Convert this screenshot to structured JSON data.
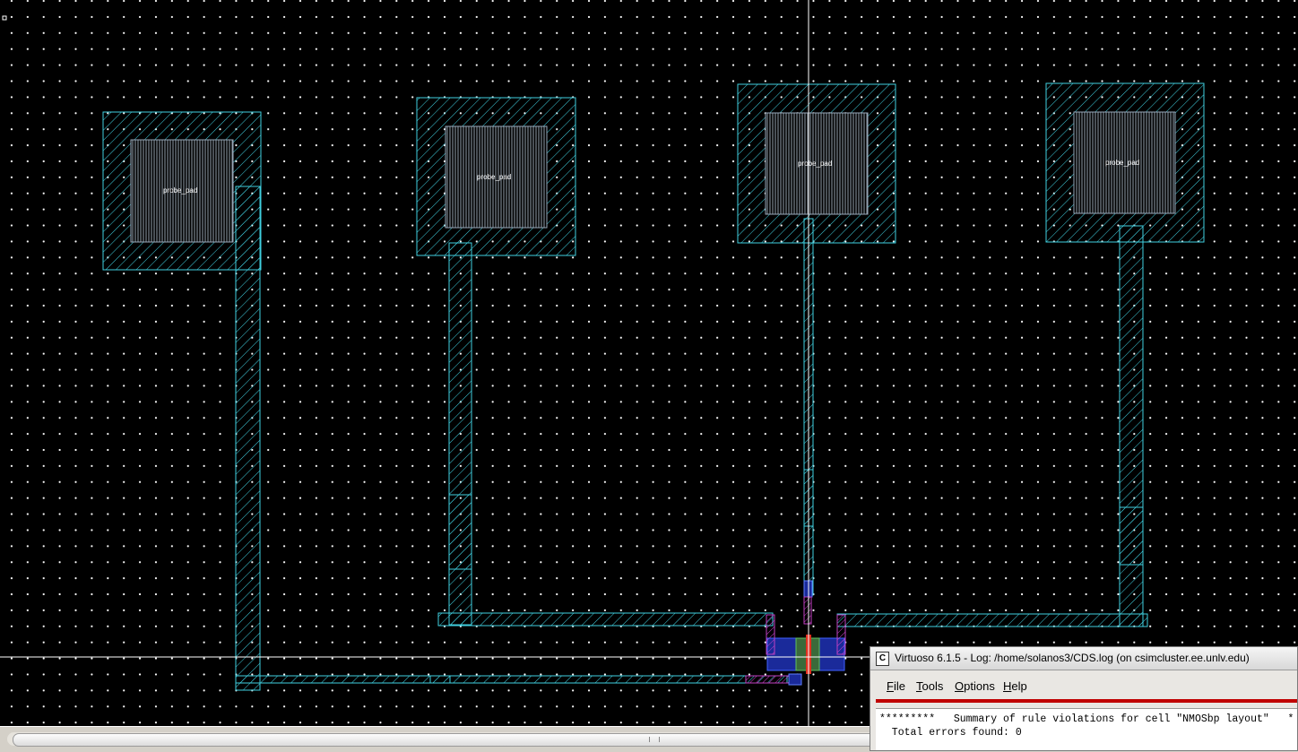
{
  "canvas": {
    "background": "#000000",
    "shape_color": "#40d0e0",
    "pad_labels": [
      "probe_pad",
      "probe_pad",
      "probe_pad",
      "probe_pad"
    ]
  },
  "log_window": {
    "title": "Virtuoso 6.1.5 - Log: /home/solanos3/CDS.log (on csimcluster.ee.unlv.edu)",
    "app_icon_glyph": "C",
    "menu": {
      "file": {
        "u": "F",
        "rest": "ile"
      },
      "tools": {
        "u": "T",
        "rest": "ools"
      },
      "options": {
        "u": "O",
        "rest": "ptions"
      },
      "help": {
        "u": "H",
        "rest": "elp"
      }
    },
    "lines": [
      "*********   Summary of rule violations for cell \"NMOSbp layout\"   *",
      "  Total errors found: 0"
    ]
  }
}
